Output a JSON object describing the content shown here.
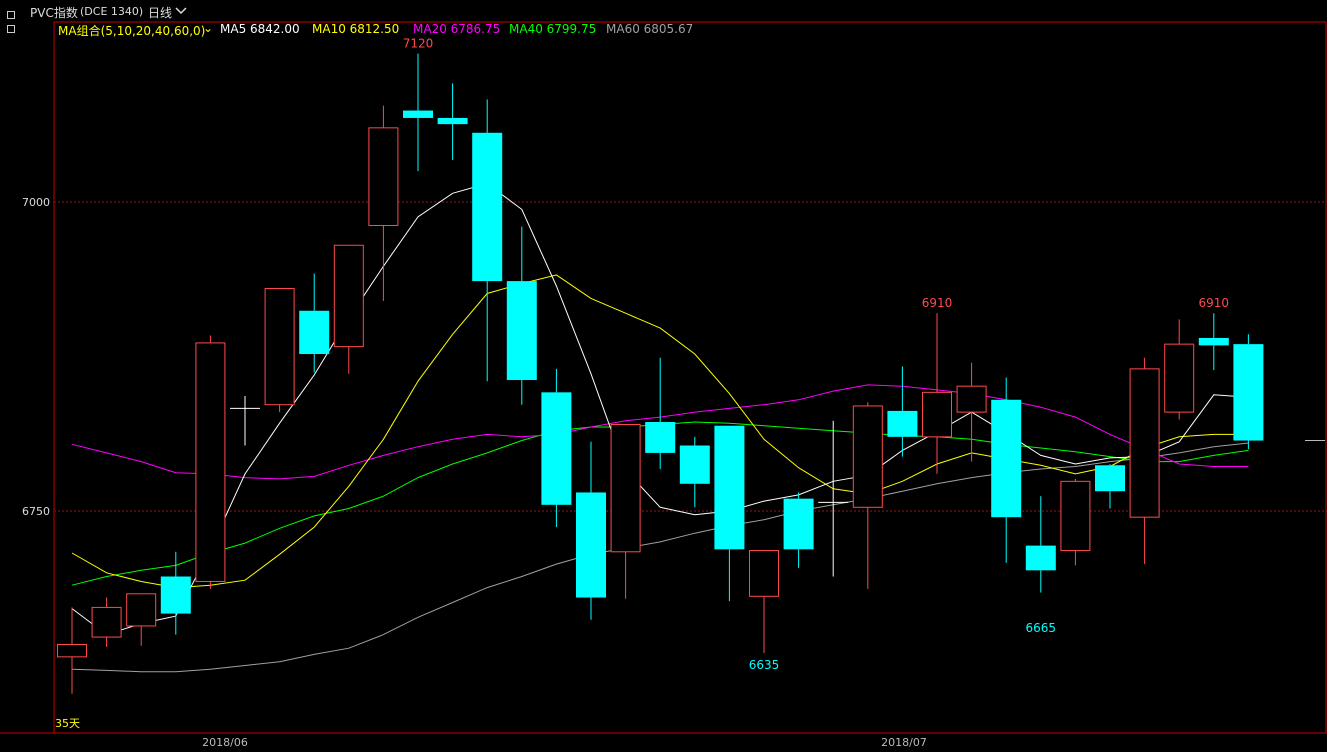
{
  "title": {
    "symbol": "PVC指数",
    "code": "(DCE 1340)",
    "period": "日线",
    "period_chevron_icon": "chevron-down-icon"
  },
  "ma_legend": {
    "group_label": "MA组合(5,10,20,40,60,0)",
    "group_chevron_icon": "chevron-down-icon",
    "items": [
      {
        "label": "MA5 6842.00",
        "color": "#ffffff"
      },
      {
        "label": "MA10 6812.50",
        "color": "#ffff00"
      },
      {
        "label": "MA20 6786.75",
        "color": "#ff00ff"
      },
      {
        "label": "MA40 6799.75",
        "color": "#00ff00"
      },
      {
        "label": "MA60 6805.67",
        "color": "#a0a0a0"
      }
    ],
    "group_color": "#ffff00"
  },
  "chart_data": {
    "type": "candlestick",
    "y_ticks": [
      7000,
      6750
    ],
    "y_range": [
      6605,
      7128
    ],
    "x_labels": [
      "2018/06",
      "2018/07"
    ],
    "colors": {
      "up": "#ff4a4a",
      "down": "#00ffff",
      "doji": "#ffffff",
      "grid": "#8a1a1a",
      "axis": "#cc0000"
    },
    "candles": [
      {
        "o": 6632,
        "h": 6672,
        "l": 6602,
        "c": 6642
      },
      {
        "o": 6648,
        "h": 6680,
        "l": 6640,
        "c": 6672
      },
      {
        "o": 6657,
        "h": 6680,
        "l": 6641,
        "c": 6683
      },
      {
        "o": 6697,
        "h": 6717,
        "l": 6650,
        "c": 6667
      },
      {
        "o": 6693,
        "h": 6892,
        "l": 6687,
        "c": 6886
      },
      {
        "o": 6833,
        "h": 6843,
        "l": 6803,
        "c": 6833
      },
      {
        "o": 6836,
        "h": 6917,
        "l": 6830,
        "c": 6930
      },
      {
        "o": 6912,
        "h": 6942,
        "l": 6862,
        "c": 6877
      },
      {
        "o": 6883,
        "h": 6945,
        "l": 6861,
        "c": 6965
      },
      {
        "o": 6981,
        "h": 7078,
        "l": 6920,
        "c": 7060
      },
      {
        "o": 7074,
        "h": 7120,
        "l": 7025,
        "c": 7068
      },
      {
        "o": 7068,
        "h": 7096,
        "l": 7034,
        "c": 7063
      },
      {
        "o": 7056,
        "h": 7083,
        "l": 6855,
        "c": 6936
      },
      {
        "o": 6936,
        "h": 6980,
        "l": 6836,
        "c": 6856
      },
      {
        "o": 6846,
        "h": 6865,
        "l": 6737,
        "c": 6755
      },
      {
        "o": 6765,
        "h": 6806,
        "l": 6662,
        "c": 6680
      },
      {
        "o": 6717,
        "h": 6820,
        "l": 6679,
        "c": 6820
      },
      {
        "o": 6822,
        "h": 6874,
        "l": 6784,
        "c": 6797
      },
      {
        "o": 6803,
        "h": 6810,
        "l": 6753,
        "c": 6772
      },
      {
        "o": 6819,
        "h": 6819,
        "l": 6677,
        "c": 6719
      },
      {
        "o": 6681,
        "h": 6716,
        "l": 6635,
        "c": 6718
      },
      {
        "o": 6760,
        "h": 6765,
        "l": 6704,
        "c": 6719
      },
      {
        "o": 6757,
        "h": 6823,
        "l": 6697,
        "c": 6757
      },
      {
        "o": 6753,
        "h": 6838,
        "l": 6687,
        "c": 6835
      },
      {
        "o": 6831,
        "h": 6867,
        "l": 6794,
        "c": 6810
      },
      {
        "o": 6810,
        "h": 6910,
        "l": 6780,
        "c": 6846
      },
      {
        "o": 6830,
        "h": 6870,
        "l": 6790,
        "c": 6851
      },
      {
        "o": 6840,
        "h": 6858,
        "l": 6708,
        "c": 6745
      },
      {
        "o": 6722,
        "h": 6762,
        "l": 6684,
        "c": 6702
      },
      {
        "o": 6718,
        "h": 6776,
        "l": 6706,
        "c": 6774
      },
      {
        "o": 6787,
        "h": 6788,
        "l": 6752,
        "c": 6766
      },
      {
        "o": 6745,
        "h": 6874,
        "l": 6707,
        "c": 6865
      },
      {
        "o": 6830,
        "h": 6905,
        "l": 6824,
        "c": 6885
      },
      {
        "o": 6890,
        "h": 6910,
        "l": 6864,
        "c": 6884
      },
      {
        "o": 6885,
        "h": 6893,
        "l": 6800,
        "c": 6807
      }
    ],
    "ma5": [
      6671,
      6650,
      6659,
      6665,
      6719,
      6780,
      6821,
      6860,
      6906,
      6948,
      6988,
      7007,
      7015,
      6994,
      6932,
      6861,
      6783,
      6753,
      6747,
      6750,
      6758,
      6763,
      6774,
      6779,
      6799,
      6814,
      6830,
      6813,
      6795,
      6788,
      6793,
      6794,
      6806,
      6844,
      6842
    ],
    "ma10": [
      6716,
      6700,
      6693,
      6688,
      6690,
      6694,
      6715,
      6737,
      6770,
      6808,
      6855,
      6893,
      6926,
      6934,
      6941,
      6922,
      6910,
      6898,
      6877,
      6845,
      6808,
      6785,
      6768,
      6764,
      6774,
      6788,
      6797,
      6792,
      6787,
      6780,
      6786,
      6801,
      6810,
      6812,
      6812
    ],
    "ma20": [
      6804,
      6797,
      6790,
      6781,
      6780,
      6777,
      6776,
      6778,
      6787,
      6795,
      6802,
      6808,
      6812,
      6810,
      6812,
      6818,
      6823,
      6826,
      6830,
      6833,
      6836,
      6840,
      6847,
      6852,
      6851,
      6848,
      6845,
      6840,
      6834,
      6826,
      6812,
      6800,
      6788,
      6786,
      6786
    ],
    "ma40": [
      6690,
      6697,
      6702,
      6706,
      6716,
      6724,
      6736,
      6746,
      6752,
      6762,
      6777,
      6788,
      6797,
      6807,
      6815,
      6818,
      6818,
      6820,
      6822,
      6821,
      6819,
      6817,
      6815,
      6813,
      6811,
      6810,
      6808,
      6804,
      6801,
      6798,
      6794,
      6790,
      6790,
      6795,
      6799
    ],
    "ma60": [
      6622,
      6621,
      6620,
      6620,
      6622,
      6625,
      6628,
      6634,
      6639,
      6650,
      6664,
      6676,
      6688,
      6697,
      6707,
      6715,
      6720,
      6725,
      6732,
      6738,
      6743,
      6750,
      6755,
      6760,
      6766,
      6772,
      6777,
      6781,
      6784,
      6786,
      6790,
      6793,
      6797,
      6802,
      6805
    ],
    "annotations": [
      {
        "label": "7120",
        "candle": 10,
        "value": 7120,
        "pos": "above",
        "color": "#ff4a4a"
      },
      {
        "label": "6635",
        "candle": 20,
        "value": 6635,
        "pos": "below",
        "color": "#00ffff"
      },
      {
        "label": "6910",
        "candle": 25,
        "value": 6910,
        "pos": "above",
        "color": "#ff4a4a"
      },
      {
        "label": "6665",
        "candle": 28,
        "value": 6665,
        "pos": "below",
        "color": "#00ffff"
      },
      {
        "label": "6910",
        "candle": 33,
        "value": 6910,
        "pos": "above",
        "color": "#ff4a4a"
      }
    ],
    "footer_label": "35天",
    "footer_label_color": "#ffff00"
  }
}
